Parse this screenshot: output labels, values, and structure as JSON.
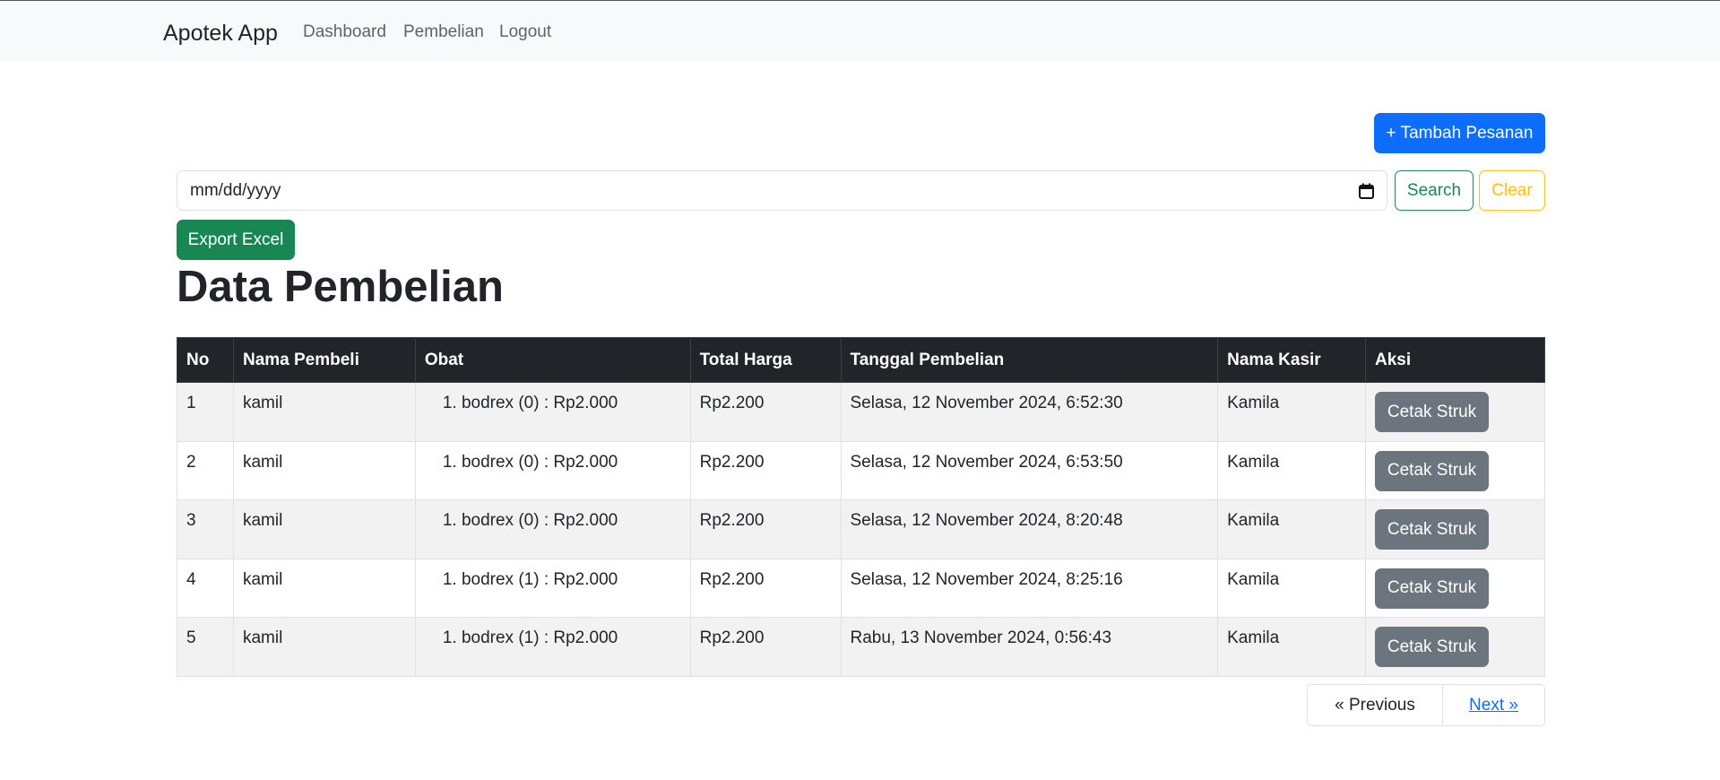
{
  "navbar": {
    "brand": "Apotek App",
    "links": [
      "Dashboard",
      "Pembelian",
      "Logout"
    ]
  },
  "actions": {
    "add_label": "+ Tambah Pesanan",
    "search_label": "Search",
    "clear_label": "Clear",
    "export_label": "Export Excel"
  },
  "filter": {
    "date_placeholder": "mm/dd/yyyy"
  },
  "page_title": "Data Pembelian",
  "table": {
    "headers": [
      "No",
      "Nama Pembeli",
      "Obat",
      "Total Harga",
      "Tanggal Pembelian",
      "Nama Kasir",
      "Aksi"
    ],
    "rows": [
      {
        "no": "1",
        "nama": "kamil",
        "obat": "1. bodrex (0) : Rp2.000",
        "total": "Rp2.200",
        "tanggal": "Selasa, 12 November 2024, 6:52:30",
        "kasir": "Kamila",
        "aksi": "Cetak Struk"
      },
      {
        "no": "2",
        "nama": "kamil",
        "obat": "1. bodrex (0) : Rp2.000",
        "total": "Rp2.200",
        "tanggal": "Selasa, 12 November 2024, 6:53:50",
        "kasir": "Kamila",
        "aksi": "Cetak Struk"
      },
      {
        "no": "3",
        "nama": "kamil",
        "obat": "1. bodrex (0) : Rp2.000",
        "total": "Rp2.200",
        "tanggal": "Selasa, 12 November 2024, 8:20:48",
        "kasir": "Kamila",
        "aksi": "Cetak Struk"
      },
      {
        "no": "4",
        "nama": "kamil",
        "obat": "1. bodrex (1) : Rp2.000",
        "total": "Rp2.200",
        "tanggal": "Selasa, 12 November 2024, 8:25:16",
        "kasir": "Kamila",
        "aksi": "Cetak Struk"
      },
      {
        "no": "5",
        "nama": "kamil",
        "obat": "1. bodrex (1) : Rp2.000",
        "total": "Rp2.200",
        "tanggal": "Rabu, 13 November 2024, 0:56:43",
        "kasir": "Kamila",
        "aksi": "Cetak Struk"
      }
    ]
  },
  "pagination": {
    "prev_label": "« Previous",
    "next_label": "Next »"
  },
  "icons": {
    "calendar": "calendar-icon"
  },
  "colors": {
    "primary": "#0d6efd",
    "success": "#198754",
    "warning": "#ffc107",
    "secondary": "#6c757d",
    "dark": "#212529"
  }
}
